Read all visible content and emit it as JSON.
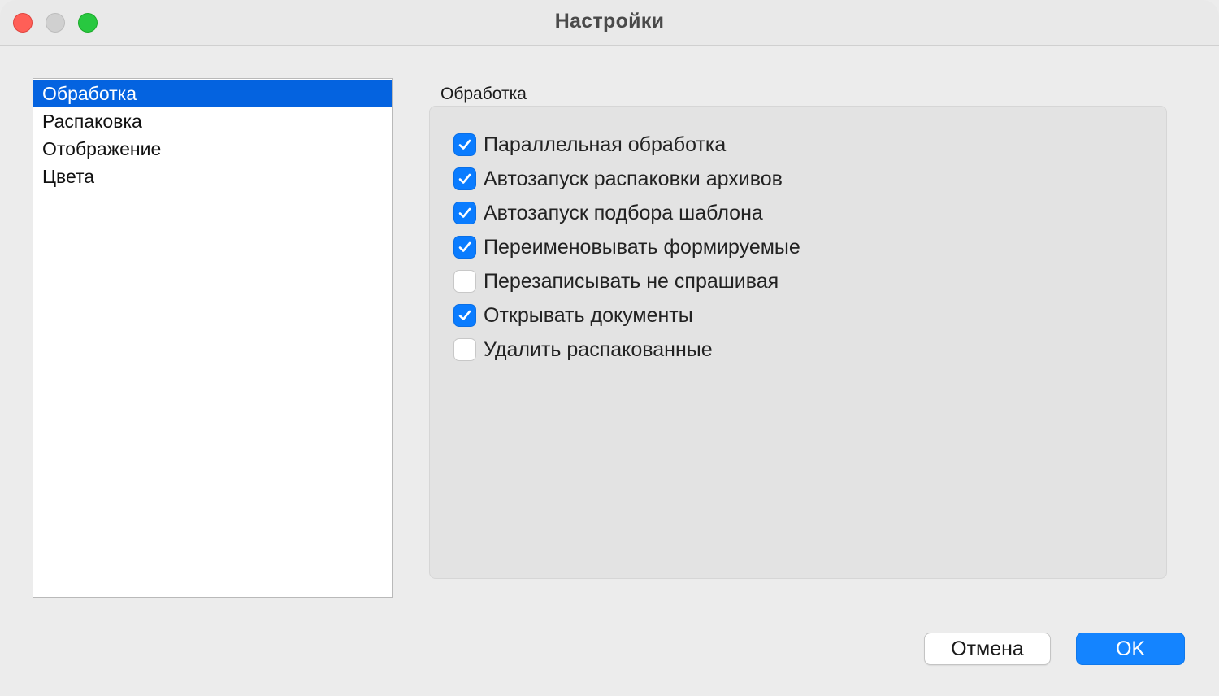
{
  "window": {
    "title": "Настройки"
  },
  "sidebar": {
    "items": [
      {
        "label": "Обработка",
        "selected": true
      },
      {
        "label": "Распаковка",
        "selected": false
      },
      {
        "label": "Отображение",
        "selected": false
      },
      {
        "label": "Цвета",
        "selected": false
      }
    ]
  },
  "panel": {
    "group_title": "Обработка",
    "options": [
      {
        "label": "Параллельная обработка",
        "checked": true
      },
      {
        "label": "Автозапуск распаковки архивов",
        "checked": true
      },
      {
        "label": "Автозапуск подбора шаблона",
        "checked": true
      },
      {
        "label": "Переименовывать формируемые",
        "checked": true
      },
      {
        "label": "Перезаписывать не спрашивая",
        "checked": false
      },
      {
        "label": "Открывать документы",
        "checked": true
      },
      {
        "label": "Удалить распакованные",
        "checked": false
      }
    ]
  },
  "footer": {
    "cancel_label": "Отмена",
    "ok_label": "OK"
  },
  "colors": {
    "accent": "#0a7cff",
    "selection": "#0463e0",
    "close": "#ff5f57",
    "zoom": "#28c840"
  },
  "icons": {
    "check": "checkmark-icon"
  }
}
